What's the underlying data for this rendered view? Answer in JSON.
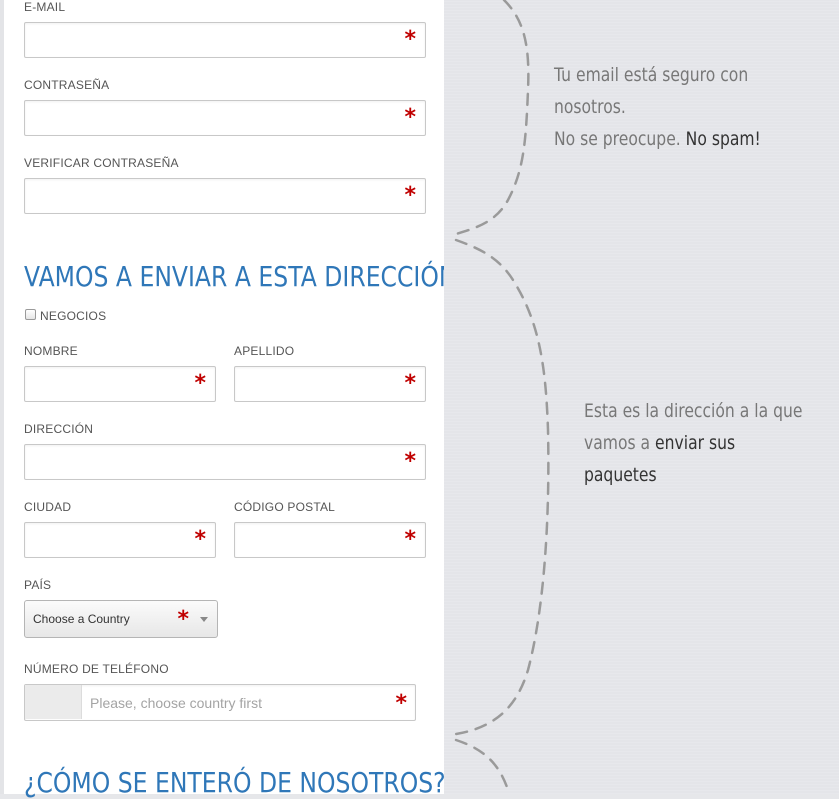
{
  "account": {
    "email_label": "E-MAIL",
    "password_label": "CONTRASEÑA",
    "verify_password_label": "VERIFICAR CONTRASEÑA",
    "required_mark": "*"
  },
  "shipping": {
    "title": "VAMOS A ENVIAR A ESTA DIRECCIÓN",
    "business_checkbox_label": "NEGOCIOS",
    "first_name_label": "NOMBRE",
    "last_name_label": "APELLIDO",
    "address_label": "DIRECCIÓN",
    "city_label": "CIUDAD",
    "postal_code_label": "CÓDIGO POSTAL",
    "country_label": "PAÍS",
    "country_select_value": "Choose a Country",
    "phone_label": "NÚMERO DE TELÉFONO",
    "phone_placeholder": "Please, choose country first"
  },
  "referral": {
    "title": "¿CÓMO SE ENTERÓ DE NOSOTROS?"
  },
  "notes": {
    "email_note": {
      "line1": "Tu email está seguro con",
      "line2": "nosotros.",
      "line3_plain": "No se preocupe. ",
      "line3_strong": "No spam!"
    },
    "address_note": {
      "line1": "Esta es la dirección a la que",
      "line2_plain": "vamos a ",
      "line2_strong": "enviar sus",
      "line3_strong": "paquetes"
    }
  },
  "colors": {
    "accent": "#2f77b8",
    "required": "#c00000",
    "panel_bg": "#e4e5e9"
  }
}
